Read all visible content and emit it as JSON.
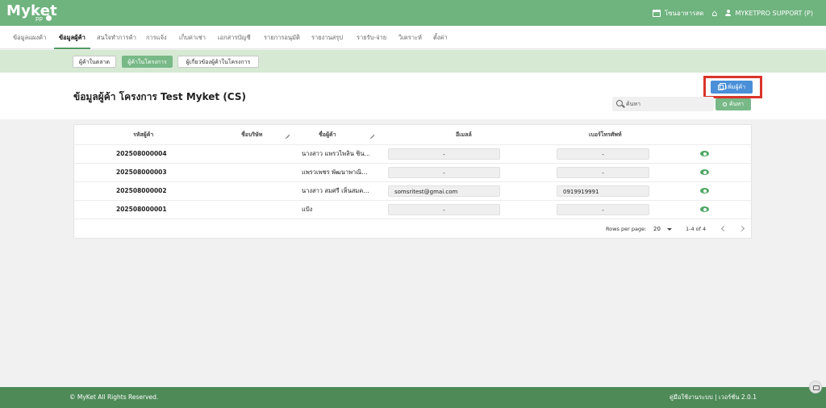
{
  "app": {
    "logo": "Myket",
    "logo_sub": "pp"
  },
  "topbar": {
    "store_label": "โซนอาหารสด",
    "user_label": "MYKETPRO SUPPORT (P)"
  },
  "nav": {
    "items": [
      {
        "label": "ข้อมูลแผงค้า"
      },
      {
        "label": "ข้อมูลผู้ค้า"
      },
      {
        "label": "สนใจทำการค้า"
      },
      {
        "label": "การแจ้ง"
      },
      {
        "label": "เก็บค่าเช่า"
      },
      {
        "label": "เอกสารบัญชี"
      },
      {
        "label": "รายการอนุมัติ"
      },
      {
        "label": "รายงานสรุป"
      },
      {
        "label": "รายรับ-จ่าย"
      },
      {
        "label": "วิเคราะห์"
      },
      {
        "label": "ตั้งค่า"
      }
    ],
    "active_index": 1
  },
  "subtabs": [
    {
      "label": "ผู้ค้าในตลาด"
    },
    {
      "label": "ผู้ค้าในโครงการ"
    },
    {
      "label": "ผู้เกี่ยวข้องผู้ค้าในโครงการ"
    }
  ],
  "page": {
    "title": "ข้อมูลผู้ค้า โครงการ Test Myket (CS)",
    "add_button": "เพิ่มผู้ค้า",
    "search_placeholder": "ค้นหา",
    "search_button": "ค้นหา"
  },
  "table": {
    "columns": [
      "รหัสผู้ค้า",
      "ชื่อบริษัท",
      "ชื่อผู้ค้า",
      "อีเมลล์",
      "เบอร์โทรศัพท์"
    ],
    "rows": [
      {
        "code": "202508000004",
        "company": "",
        "name": "นางสาว แพรวไพลิน ชิน…",
        "email": "-",
        "phone": "-"
      },
      {
        "code": "202508000003",
        "company": "",
        "name": "แพรวเพชร พัฒนาพาณิ…",
        "email": "-",
        "phone": "-"
      },
      {
        "code": "202508000002",
        "company": "",
        "name": "นางสาว สมศรี เห็นสมค…",
        "email": "somsritest@gmai.com",
        "phone": "0919919991"
      },
      {
        "code": "202508000001",
        "company": "",
        "name": "แป้ง",
        "email": "-",
        "phone": "-"
      }
    ],
    "rows_per_page_label": "Rows per page:",
    "rows_per_page": "20",
    "range": "1-4 of 4"
  },
  "footer": {
    "copyright": "© MyKet All Rights Reserved.",
    "right": "คู่มือใช้งานระบบ | เวอร์ชั่น 2.0.1"
  },
  "colors": {
    "primary_green": "#6fb37f",
    "footer_green": "#4d8a57",
    "blue_button": "#4a8fd8",
    "highlight_red": "#d9352a"
  }
}
